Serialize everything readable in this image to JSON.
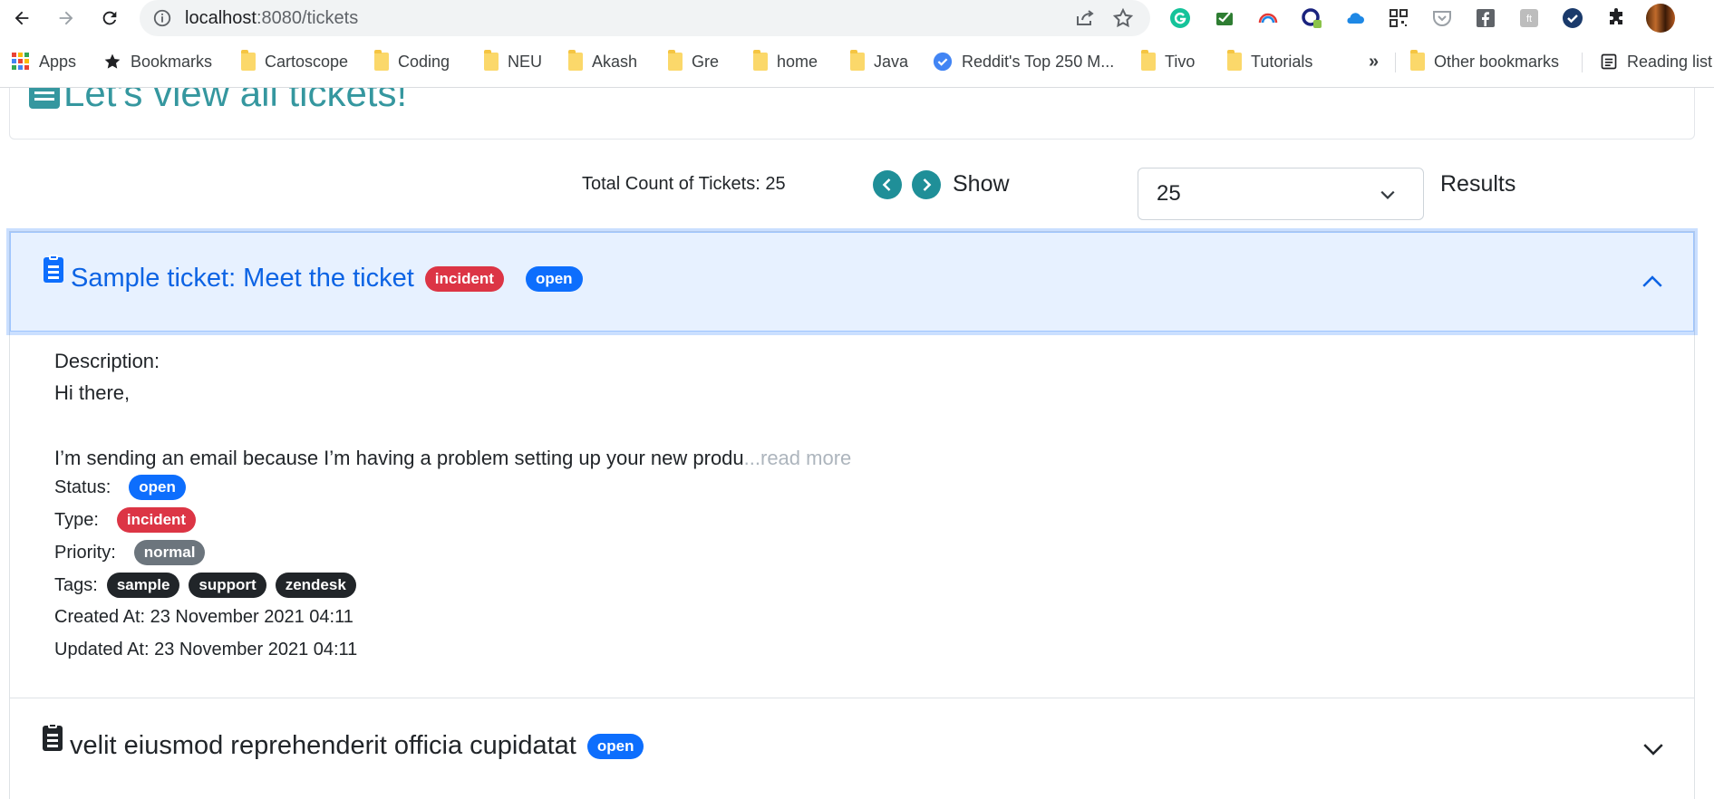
{
  "browser": {
    "url_host": "localhost",
    "url_path": ":8080/tickets",
    "bookmarks": [
      {
        "label": "Apps",
        "icon": "apps-grid-icon"
      },
      {
        "label": "Bookmarks",
        "icon": "star-icon"
      },
      {
        "label": "Cartoscope",
        "icon": "folder-icon"
      },
      {
        "label": "Coding",
        "icon": "folder-icon"
      },
      {
        "label": "NEU",
        "icon": "folder-icon"
      },
      {
        "label": "Akash",
        "icon": "folder-icon"
      },
      {
        "label": "Gre",
        "icon": "folder-icon"
      },
      {
        "label": "home",
        "icon": "folder-icon"
      },
      {
        "label": "Java",
        "icon": "folder-icon"
      },
      {
        "label": "Reddit's Top 250 M...",
        "icon": "checkmark-circle-icon"
      },
      {
        "label": "Tivo",
        "icon": "folder-icon"
      },
      {
        "label": "Tutorials",
        "icon": "folder-icon"
      },
      {
        "label": "Other bookmarks",
        "icon": "folder-icon"
      },
      {
        "label": "Reading list",
        "icon": "reading-list-icon"
      }
    ],
    "overflow_label": "»"
  },
  "page": {
    "header_title": "Let's view all tickets!",
    "total_label": "Total Count of Tickets: 25",
    "show_label": "Show",
    "page_size": "25",
    "results_label": "Results"
  },
  "tickets": [
    {
      "title": "Sample ticket: Meet the ticket",
      "type": "incident",
      "status": "open",
      "expanded": true,
      "description_label": "Description:",
      "description_line1": "Hi there,",
      "description_line2": "I’m sending an email because I’m having a problem setting up your new produ",
      "read_more": "...read more",
      "status_label": "Status:",
      "type_label": "Type:",
      "priority_label": "Priority:",
      "priority": "normal",
      "tags_label": "Tags:",
      "tags": [
        "sample",
        "support",
        "zendesk"
      ],
      "created": "Created At: 23 November 2021 04:11",
      "updated": "Updated At: 23 November 2021 04:11"
    },
    {
      "title": "velit eiusmod reprehenderit officia cupidatat",
      "status": "open",
      "expanded": false
    }
  ],
  "colors": {
    "accent_teal": "#35979f",
    "incident_red": "#dc3545",
    "open_blue": "#0d6efd",
    "priority_gray": "#6c757d",
    "tag_dark": "#212529"
  }
}
